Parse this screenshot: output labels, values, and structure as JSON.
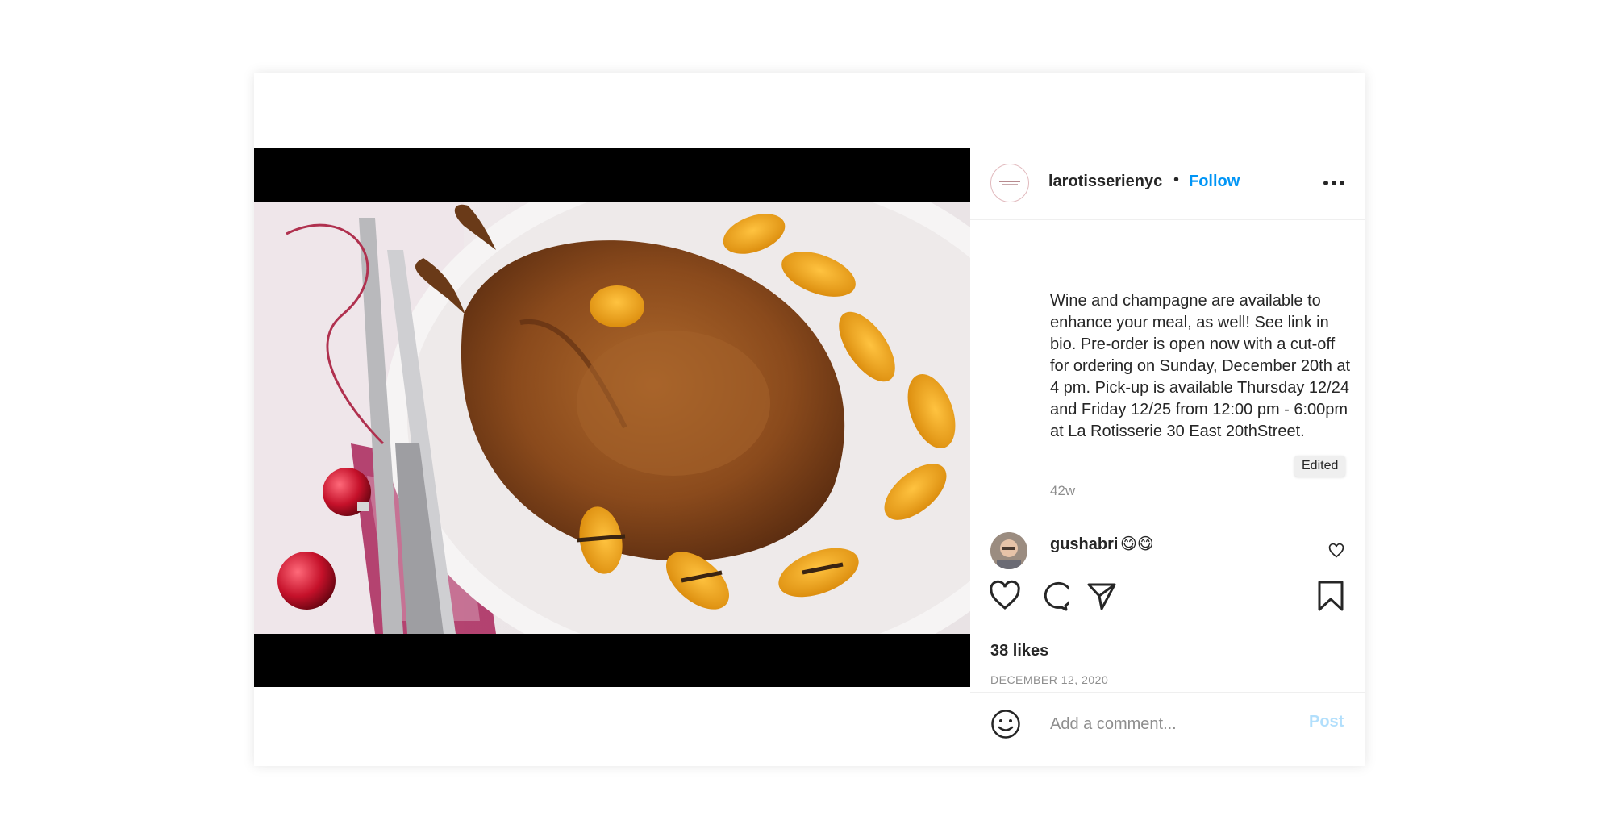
{
  "post": {
    "username": "larotisserienyc",
    "separator": "•",
    "follow_label": "Follow",
    "more_icon": "more-horizontal-icon",
    "caption": "Wine and champagne are available to enhance your meal, as well! See link in bio. Pre-order is open now with a cut-off for ordering on Sunday, December 20th at 4 pm. Pick-up is available Thursday 12/24 and Friday 12/25 from 12:00 pm - 6:00pm at La Rotisserie 30 East 20thStreet.",
    "edited_label": "Edited",
    "time_ago": "42w",
    "likes": "38 likes",
    "date": "DECEMBER 12, 2020"
  },
  "comment": {
    "username": "gushabri",
    "text": "😋😋"
  },
  "composer": {
    "placeholder": "Add a comment...",
    "post_label": "Post"
  },
  "colors": {
    "link_blue": "#0095f6",
    "post_disabled": "#b2dffc",
    "muted": "#8e8e8e"
  }
}
